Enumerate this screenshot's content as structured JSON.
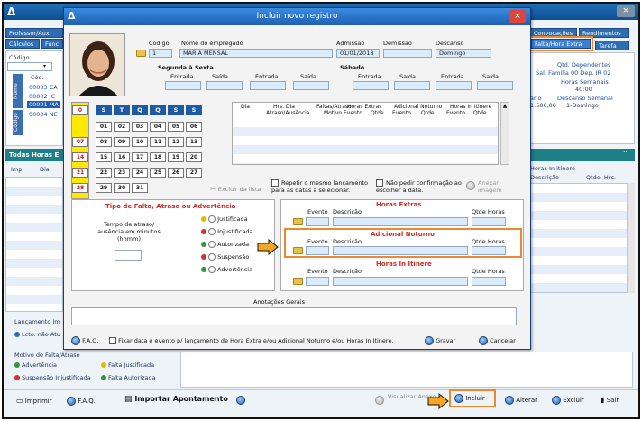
{
  "background": {
    "title_logo": "Δ",
    "close": "×",
    "tabs_left": [
      "Professor/Aux",
      "Cálculos",
      "Func"
    ],
    "tabs_right": [
      "Convocações",
      "Rendimentos",
      "Falta/Hora Extra",
      "Tarefa"
    ],
    "list": {
      "code_label": "Código",
      "cod_label": "Cód.",
      "side_labels": [
        "Nome",
        "Código"
      ],
      "rows": [
        "00003",
        "00002",
        "00001",
        "00004"
      ],
      "row_suffix": [
        "CA",
        "JC",
        "MA",
        "NE"
      ]
    },
    "summary": {
      "qtd_dependentes": "Qtd. Dependentes",
      "sal_familia": "Sal. Família 00   Dep. IR 02",
      "horas_semanais": "Horas Semanais",
      "horas_value": "40:00",
      "descanso": "Descanso Semanal",
      "descanso_value": "1-Domingo",
      "salario_label": "ário",
      "salario_value": "1.500,00"
    },
    "todas_horas": "Todas Horas E",
    "left_grid_cols": [
      "Imp.",
      "Dia"
    ],
    "right_grid": {
      "title": "Horas In itinere",
      "cols": [
        "Descrição",
        "Qtde. Hrs."
      ]
    },
    "lancamento": "Lançamento Im",
    "lcto_nao": "Lcto. não Atu",
    "motivo_label": "Motivo de Falta/Atraso",
    "motivos": [
      {
        "label": "Advertência",
        "color": "#2e9b3a"
      },
      {
        "label": "Falta Justificada",
        "color": "#e6b800"
      },
      {
        "label": "Suspensão Injustificada",
        "color": "#d63030"
      },
      {
        "label": "Falta Autorizada",
        "color": "#2e9b3a"
      }
    ],
    "bottom_bar": {
      "imprimir": "Imprimir",
      "faq": "F.A.Q.",
      "importar": "Importar Apontamento",
      "visualizar": "Visualizar Anexo",
      "incluir": "Incluir",
      "alterar": "Alterar",
      "excluir": "Excluir",
      "sair": "Sair"
    }
  },
  "modal": {
    "title": "Incluir novo registro",
    "close": "×",
    "logo": "Δ",
    "labels": {
      "codigo": "Código",
      "nome": "Nome do empregado",
      "admissao": "Admissão",
      "demissao": "Demissão",
      "descanso": "Descanso",
      "segunda_sexta": "Segunda à Sexta",
      "sabado": "Sábado",
      "entrada": "Entrada",
      "saida": "Saída"
    },
    "values": {
      "codigo": "1",
      "nome": "MARIA MENSAL",
      "admissao": "01/01/2018",
      "demissao": "",
      "descanso": "Domingo"
    },
    "calendar": {
      "month_marker": "0",
      "weekdays": [
        "S",
        "T",
        "Q",
        "Q",
        "S",
        "S"
      ],
      "weeks": [
        {
          "sun": "",
          "days": [
            "01",
            "02",
            "03",
            "04",
            "05",
            "06"
          ]
        },
        {
          "sun": "07",
          "days": [
            "08",
            "09",
            "10",
            "11",
            "12",
            "13"
          ]
        },
        {
          "sun": "14",
          "days": [
            "15",
            "16",
            "17",
            "18",
            "19",
            "20"
          ]
        },
        {
          "sun": "21",
          "days": [
            "22",
            "23",
            "24",
            "25",
            "26",
            "27"
          ]
        },
        {
          "sun": "28",
          "days": [
            "29",
            "30",
            "31",
            "",
            "",
            ""
          ]
        }
      ]
    },
    "table_headers": {
      "dia": "Dia",
      "hrs_dia": "Hrs. Dia",
      "atraso_ausencia": "Atraso/Ausência",
      "faltas_atraso": "Faltas/Atraso",
      "motivo": "Motivo",
      "horas_extras": "Horas Extras",
      "adicional": "Adicional Noturno",
      "itinere": "Horas In Itinere",
      "evento": "Evento",
      "qtde": "Qtde"
    },
    "actions": {
      "excluir_lista": "Excluir da lista",
      "repetir": "Repetir o mesmo lançamento para as datas a selecionar.",
      "nao_pedir": "Não pedir confirmação ao escolher a data.",
      "anexar": "Anexar imagem"
    },
    "tipo_falta": {
      "title": "Tipo de Falta, Atraso ou Advertência",
      "tempo_label": "Tempo de atraso/ ausência em minutos (hhmm)",
      "options": [
        {
          "label": "Justificada",
          "color": "#e6b800"
        },
        {
          "label": "Injustificada",
          "color": "#d63030"
        },
        {
          "label": "Autorizada",
          "color": "#2e9b3a"
        },
        {
          "label": "Suspensão",
          "color": "#d63030"
        },
        {
          "label": "Advertência",
          "color": "#2e9b3a"
        }
      ]
    },
    "sections": [
      {
        "title": "Horas Extras",
        "evento": "Evento",
        "descricao": "Descrição",
        "qtde": "Qtde Horas"
      },
      {
        "title": "Adicional Noturno",
        "evento": "Evento",
        "descricao": "Descrição",
        "qtde": "Qtde Horas"
      },
      {
        "title": "Horas In Itinere",
        "evento": "Evento",
        "descricao": "Descrição",
        "qtde": "Qtde Horas"
      }
    ],
    "anotacoes": "Anotações Gerais",
    "footer": {
      "faq": "F.A.Q.",
      "fixar": "Fixar data e evento p/ lançamento de Hora Extra e/ou Adicional Noturno e/ou Horas In Itinere.",
      "gravar": "Gravar",
      "cancelar": "Cancelar"
    }
  },
  "colors": {
    "accent": "#1f5fb0",
    "highlight": "#f0862e",
    "section_title": "#d22e25"
  }
}
